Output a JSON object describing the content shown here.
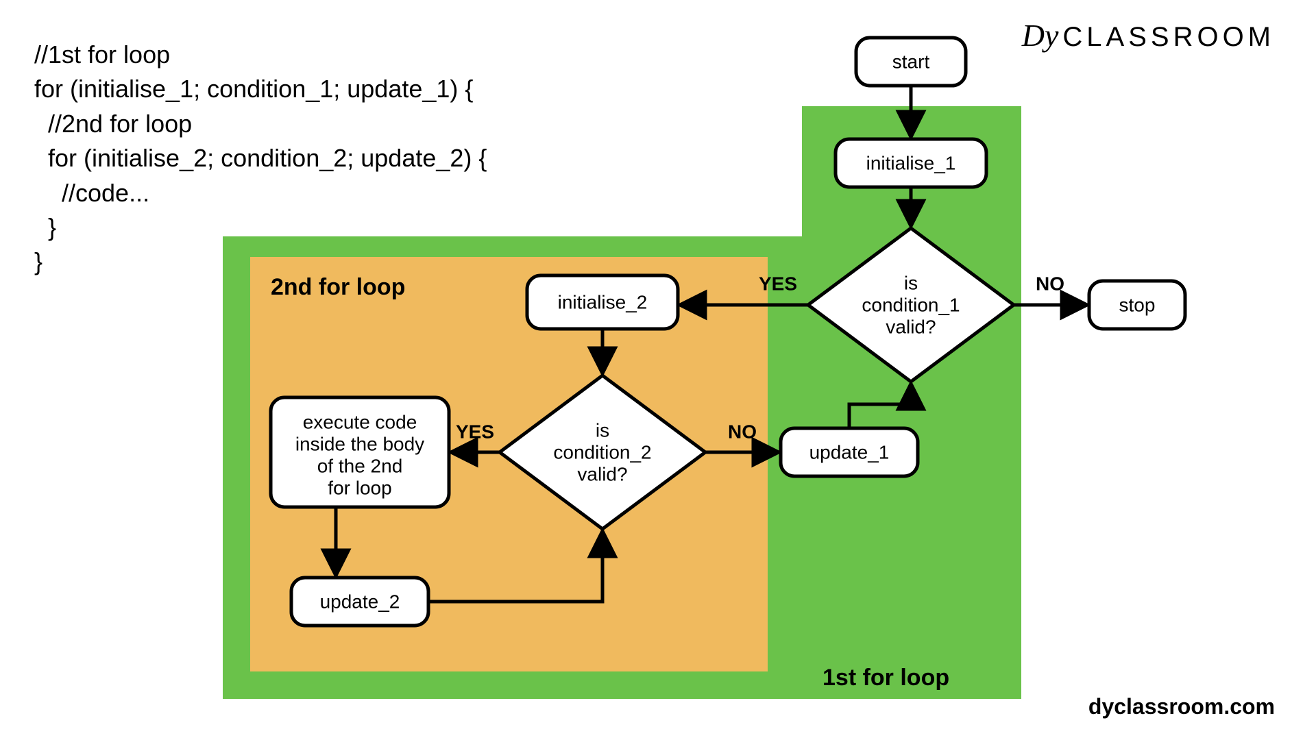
{
  "code_text": "//1st for loop\nfor (initialise_1; condition_1; update_1) {\n  //2nd for loop\n  for (initialise_2; condition_2; update_2) {\n    //code...\n  }\n}",
  "brand_prefix": "Dy",
  "brand": "CLASSROOM",
  "footer": "dyclassroom.com",
  "outer_title": "1st for loop",
  "inner_title": "2nd for loop",
  "nodes": {
    "start": "start",
    "init1": "initialise_1",
    "cond1_l1": "is",
    "cond1_l2": "condition_1",
    "cond1_l3": "valid?",
    "stop": "stop",
    "init2": "initialise_2",
    "cond2_l1": "is",
    "cond2_l2": "condition_2",
    "cond2_l3": "valid?",
    "update1": "update_1",
    "exec_l1": "execute code",
    "exec_l2": "inside the body",
    "exec_l3": "of the 2nd",
    "exec_l4": "for loop",
    "update2": "update_2"
  },
  "labels": {
    "yes": "YES",
    "no": "NO"
  },
  "colors": {
    "outer": "#6ac24a",
    "inner": "#f0ba5e"
  }
}
